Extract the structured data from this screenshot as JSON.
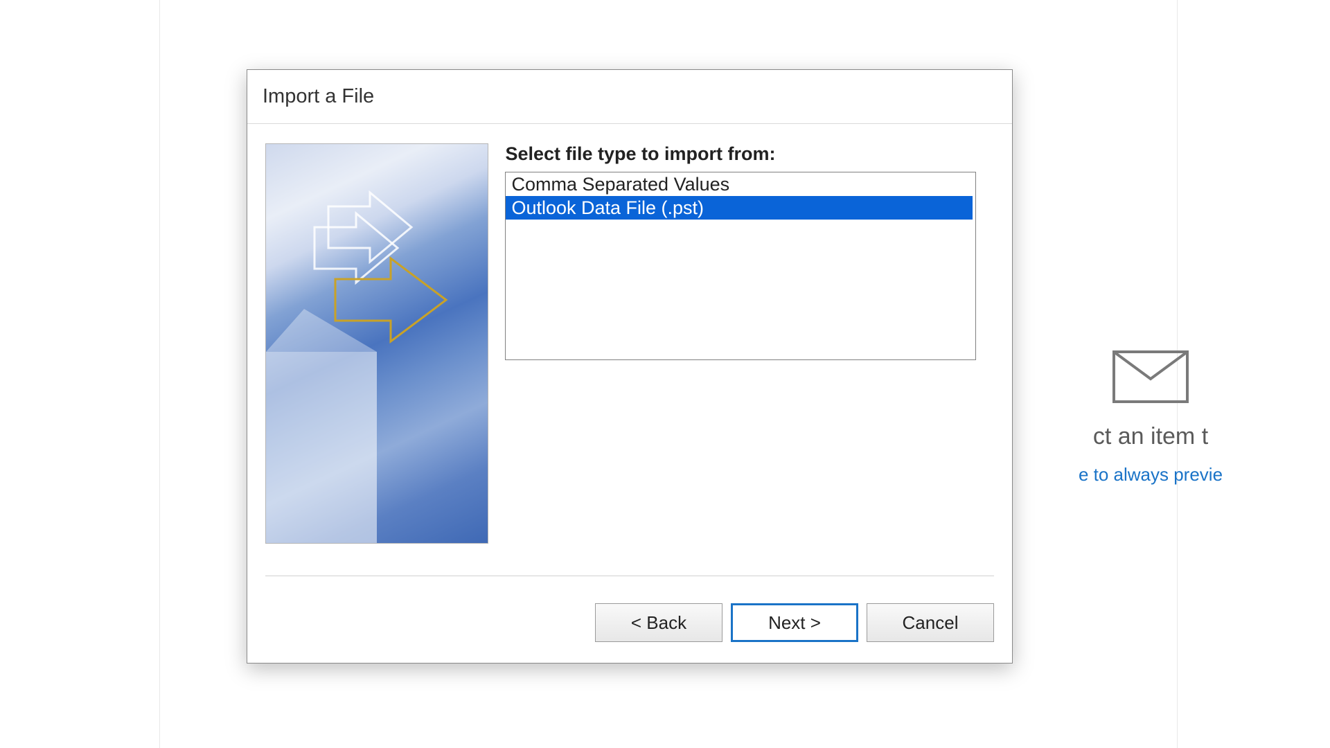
{
  "dialog": {
    "title": "Import a File",
    "select_label": "Select file type to import from:",
    "options": [
      {
        "label": "Comma Separated Values",
        "selected": false
      },
      {
        "label": "Outlook Data File (.pst)",
        "selected": true
      }
    ],
    "buttons": {
      "back": "<  Back",
      "next": "Next  >",
      "cancel": "Cancel"
    }
  },
  "background": {
    "preview_line1": "ct an item t",
    "preview_line2": "e to always previe"
  }
}
